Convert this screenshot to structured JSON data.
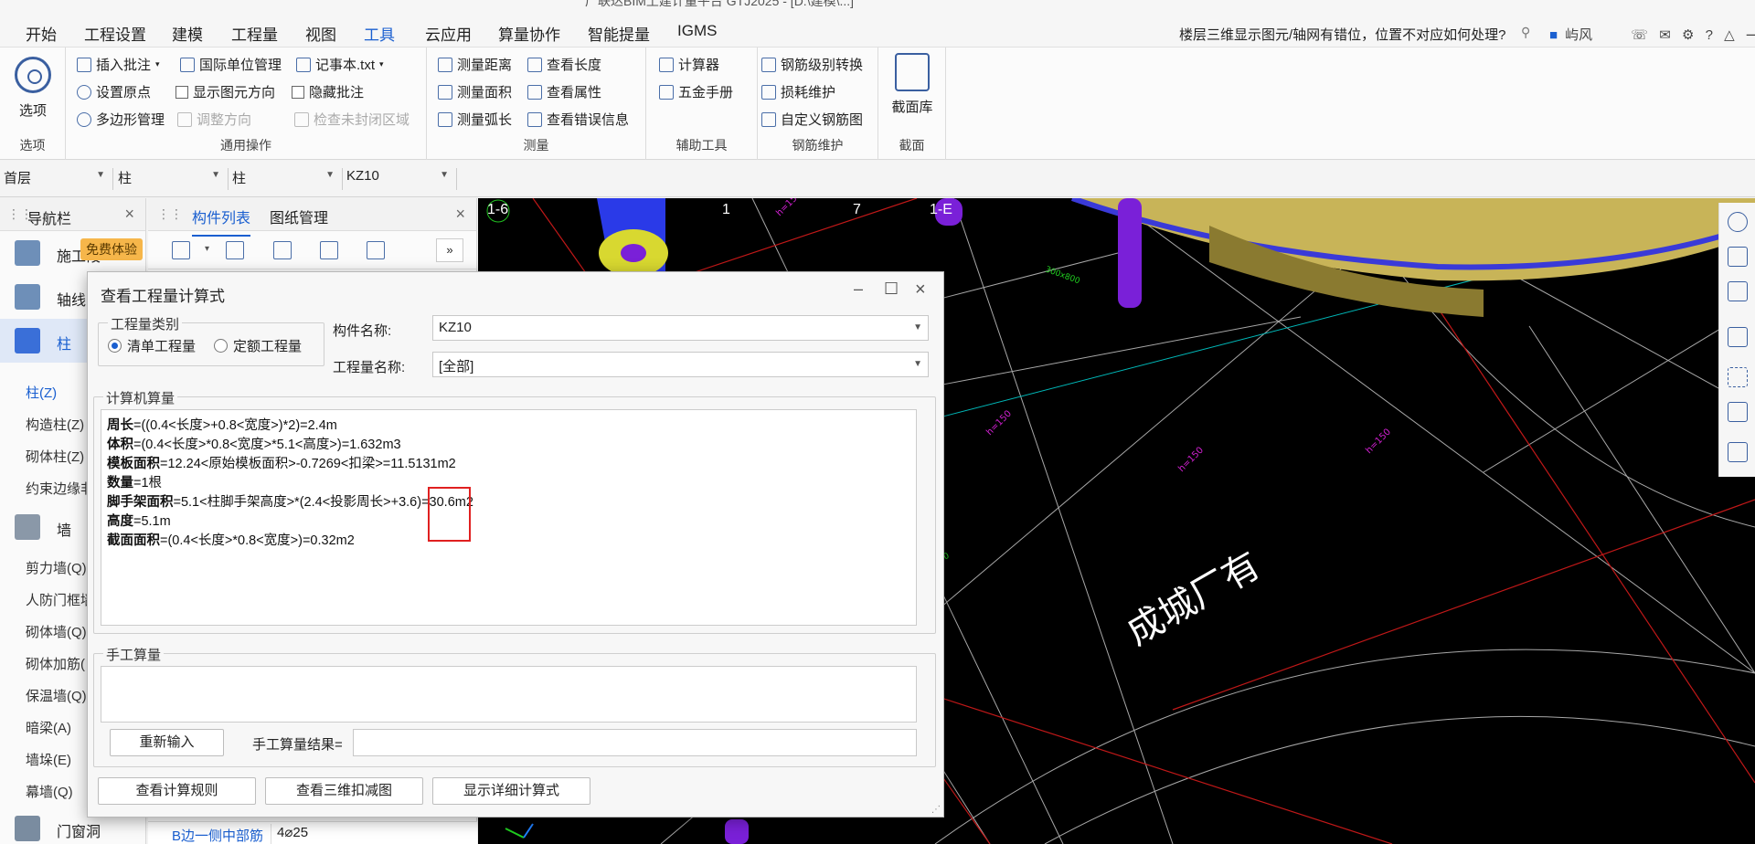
{
  "window": {
    "title_partial": "广联达BIM土建计量平台 GTJ2025 - [D:\\建模\\...]"
  },
  "menubar": {
    "items": [
      "开始",
      "工程设置",
      "建模",
      "工程量",
      "视图",
      "工具",
      "云应用",
      "算量协作",
      "智能提量",
      "IGMS"
    ],
    "active": "工具",
    "help_search": "楼层三维显示图元/轴网有错位，位置不对应如何处理?",
    "user": "屿风"
  },
  "ribbon": {
    "options": {
      "label": "选项",
      "group": "选项"
    },
    "general": {
      "group": "通用操作",
      "insert_note": "插入批注",
      "intl_units": "国际单位管理",
      "notepad": "记事本.txt",
      "set_origin": "设置原点",
      "show_direction": "显示图元方向",
      "hide_note": "隐藏批注",
      "polygon_mgr": "多边形管理",
      "adjust_dir": "调整方向",
      "check_unclosed": "检查未封闭区域"
    },
    "measure": {
      "group": "测量",
      "distance": "测量距离",
      "view_length": "查看长度",
      "area": "测量面积",
      "view_props": "查看属性",
      "arc": "测量弧长",
      "view_errors": "查看错误信息"
    },
    "aux": {
      "group": "辅助工具",
      "calculator": "计算器",
      "hardware": "五金手册"
    },
    "rebar": {
      "group": "钢筋维护",
      "grade_convert": "钢筋级别转换",
      "loss": "损耗维护",
      "custom": "自定义钢筋图"
    },
    "section": {
      "group": "截面",
      "library": "截面库"
    }
  },
  "selectors": {
    "floor": "首层",
    "type1": "柱",
    "type2": "柱",
    "component": "KZ10"
  },
  "nav": {
    "title": "导航栏",
    "badge": "免费体验",
    "categories": [
      {
        "label": "施工段"
      },
      {
        "label": "轴线"
      },
      {
        "label": "柱"
      },
      {
        "label": "墙"
      },
      {
        "label": "门窗洞"
      }
    ],
    "col_items": [
      "柱(Z)",
      "构造柱(Z)",
      "砌体柱(Z)",
      "约束边缘非"
    ],
    "wall_items": [
      "剪力墙(Q)",
      "人防门框墙",
      "砌体墙(Q)",
      "砌体加筋(",
      "保温墙(Q)",
      "暗梁(A)",
      "墙垛(E)",
      "幕墙(Q)"
    ]
  },
  "comp_panel": {
    "tabs": [
      "构件列表",
      "图纸管理"
    ],
    "active_tab": "构件列表",
    "prop_key": "B边一侧中部筋",
    "prop_val": "4⌀25"
  },
  "viewport": {
    "axis_labels": [
      "1-6",
      "1",
      "7",
      "1-E"
    ]
  },
  "dialog": {
    "title": "查看工程量计算式",
    "qty_type_legend": "工程量类别",
    "radio_list": "清单工程量",
    "radio_quota": "定额工程量",
    "selected": "清单工程量",
    "comp_name_label": "构件名称:",
    "comp_name_value": "KZ10",
    "qty_name_label": "工程量名称:",
    "qty_name_value": "[全部]",
    "computer_legend": "计算机算量",
    "lines": [
      {
        "k": "周长",
        "v": "=((0.4<长度>+0.8<宽度>)*2)=2.4m"
      },
      {
        "k": "体积",
        "v": "=(0.4<长度>*0.8<宽度>*5.1<高度>)=1.632m3"
      },
      {
        "k": "模板面积",
        "v": "=12.24<原始模板面积>-0.7269<扣梁>=11.5131m2"
      },
      {
        "k": "数量",
        "v": "=1根"
      },
      {
        "k": "脚手架面积",
        "v": "=5.1<柱脚手架高度>*(2.4<投影周长>+3.6)=30.6m2"
      },
      {
        "k": "高度",
        "v": "=5.1m"
      },
      {
        "k": "截面面积",
        "v": "=(0.4<长度>*0.8<宽度>)=0.32m2"
      }
    ],
    "manual_legend": "手工算量",
    "reinput_btn": "重新输入",
    "manual_result_label": "手工算量结果=",
    "btn_rules": "查看计算规则",
    "btn_3d": "查看三维扣减图",
    "btn_detail": "显示详细计算式"
  }
}
